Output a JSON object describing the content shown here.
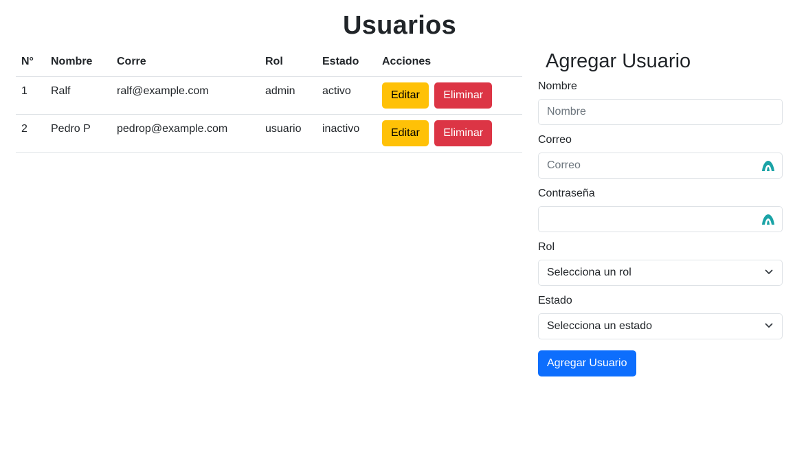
{
  "page": {
    "title": "Usuarios"
  },
  "table": {
    "headers": [
      "N°",
      "Nombre",
      "Corre",
      "Rol",
      "Estado",
      "Acciones"
    ],
    "rows": [
      {
        "num": "1",
        "name": "Ralf",
        "email": "ralf@example.com",
        "role": "admin",
        "status": "activo"
      },
      {
        "num": "2",
        "name": "Pedro P",
        "email": "pedrop@example.com",
        "role": "usuario",
        "status": "inactivo"
      }
    ],
    "edit_label": "Editar",
    "delete_label": "Eliminar"
  },
  "form": {
    "title": "Agregar Usuario",
    "name_label": "Nombre",
    "name_placeholder": "Nombre",
    "email_label": "Correo",
    "email_placeholder": "Correo",
    "password_label": "Contraseña",
    "password_placeholder": "",
    "role_label": "Rol",
    "role_selected": "Selecciona un rol",
    "status_label": "Estado",
    "status_selected": "Selecciona un estado",
    "submit_label": "Agregar Usuario"
  },
  "colors": {
    "warning": "#ffc107",
    "danger": "#dc3545",
    "primary": "#0d6efd",
    "password_manager_icon": "#1aa3a6"
  },
  "icons": {
    "select_chevron": "chevron-down-icon",
    "password_manager": "password-manager-icon"
  }
}
